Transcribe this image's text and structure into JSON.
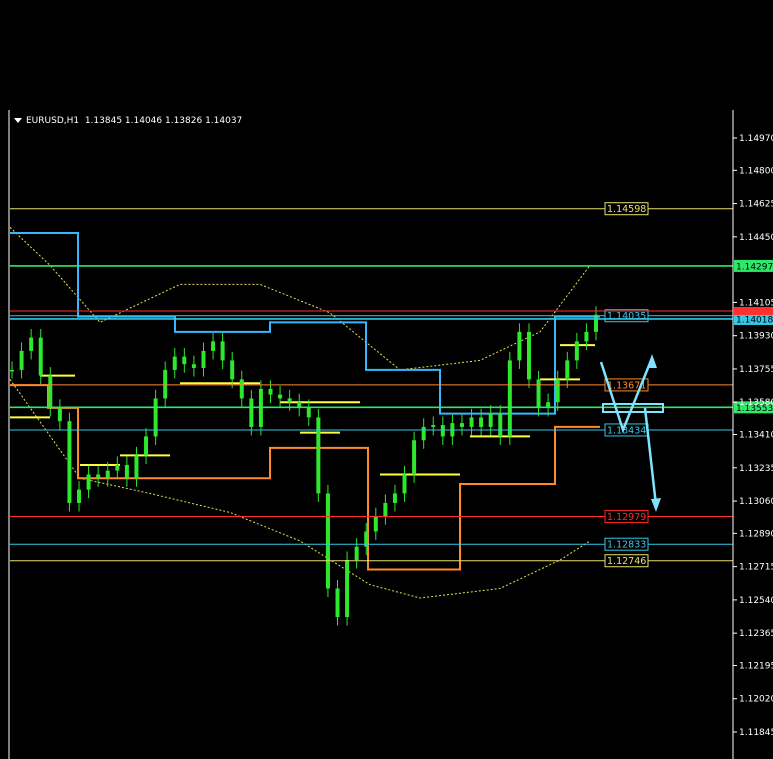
{
  "window": {
    "symbol_line": "EURUSD,H1  1.13845 1.14046 1.13826 1.14037"
  },
  "chart_data": {
    "type": "candlestick",
    "symbol": "EURUSD",
    "timeframe": "H1",
    "ohlc_last": {
      "open": 1.13845,
      "high": 1.14046,
      "low": 1.13826,
      "close": 1.14037
    },
    "y_ticks": [
      1.1497,
      1.148,
      1.14625,
      1.1445,
      1.14105,
      1.1393,
      1.13755,
      1.1358,
      1.1341,
      1.13235,
      1.1306,
      1.1289,
      1.12715,
      1.1254,
      1.12365,
      1.12195,
      1.1202,
      1.11845
    ],
    "ylim": [
      1.1175,
      1.151
    ],
    "grid": false,
    "horizontal_levels": [
      {
        "label": "1.14598",
        "value": 1.14598,
        "color": "#e8e070"
      },
      {
        "label": "1.14297",
        "value": 1.14297,
        "color": "#2ee86a",
        "axis_tag": true
      },
      {
        "label": "1.14035",
        "value": 1.14035,
        "color": "#35c8e8"
      },
      {
        "label": "1.14018",
        "value": 1.14018,
        "color": "#35c8e8",
        "axis_tag": true
      },
      {
        "label": "1.13671",
        "value": 1.13671,
        "color": "#ff8a2a"
      },
      {
        "label": "1.13553",
        "value": 1.13553,
        "color": "#2ee86a",
        "axis_tag": true
      },
      {
        "label": "1.13434",
        "value": 1.13434,
        "color": "#35c8e8"
      },
      {
        "label": "1.12979",
        "value": 1.12979,
        "color": "#ff2a2a"
      },
      {
        "label": "1.12833",
        "value": 1.12833,
        "color": "#35c8e8"
      },
      {
        "label": "1.12746",
        "value": 1.12746,
        "color": "#e8e070"
      }
    ],
    "extra_lines": [
      {
        "value": 1.1406,
        "color": "#ff3030"
      }
    ],
    "close_series": [
      1.1375,
      1.1385,
      1.1392,
      1.1372,
      1.1355,
      1.1348,
      1.1305,
      1.1312,
      1.132,
      1.1318,
      1.1322,
      1.1325,
      1.1318,
      1.133,
      1.134,
      1.136,
      1.1375,
      1.1382,
      1.1378,
      1.1376,
      1.1385,
      1.139,
      1.138,
      1.137,
      1.136,
      1.1345,
      1.1365,
      1.1362,
      1.136,
      1.1358,
      1.1355,
      1.135,
      1.131,
      1.126,
      1.1245,
      1.1275,
      1.1282,
      1.129,
      1.1298,
      1.1305,
      1.131,
      1.132,
      1.1338,
      1.1345,
      1.1346,
      1.134,
      1.1347,
      1.1345,
      1.135,
      1.1345,
      1.1352,
      1.134,
      1.138,
      1.1395,
      1.137,
      1.1355,
      1.1358,
      1.137,
      1.138,
      1.139,
      1.1395,
      1.1404
    ]
  },
  "colors": {
    "background": "#000000",
    "axis": "#ffffff",
    "candle": "#2ee82e",
    "yellow": "#ffff40",
    "orange": "#ff8a2a",
    "blue": "#35b8ff",
    "arrow": "#7fe3ff"
  }
}
